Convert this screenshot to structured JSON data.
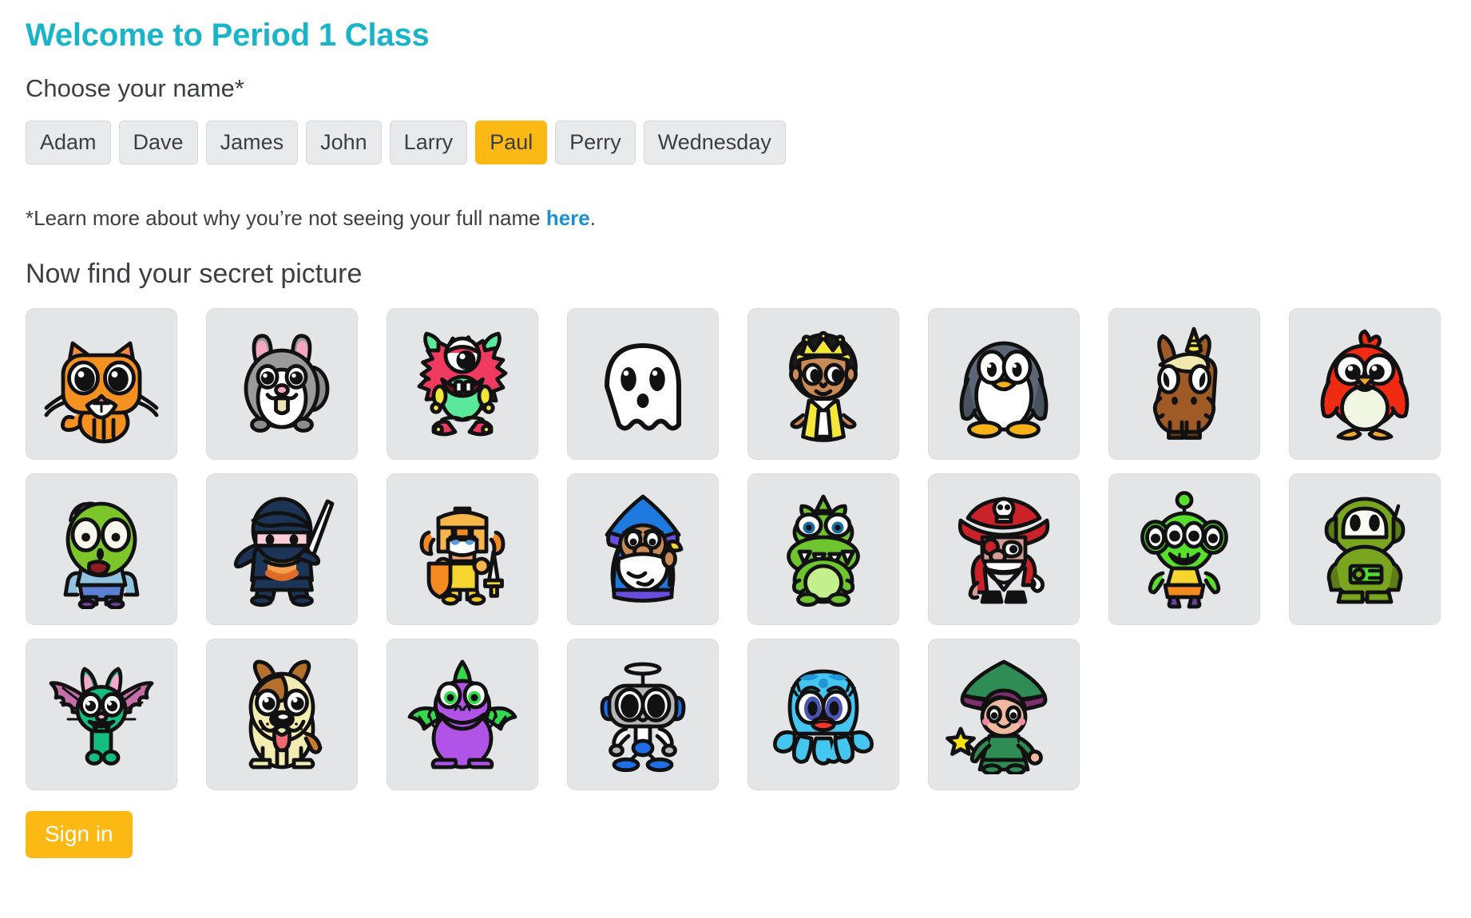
{
  "header": {
    "title": "Welcome to Period 1 Class"
  },
  "name_section": {
    "label": "Choose your name*",
    "names": [
      {
        "label": "Adam",
        "selected": false
      },
      {
        "label": "Dave",
        "selected": false
      },
      {
        "label": "James",
        "selected": false
      },
      {
        "label": "John",
        "selected": false
      },
      {
        "label": "Larry",
        "selected": false
      },
      {
        "label": "Paul",
        "selected": true
      },
      {
        "label": "Perry",
        "selected": false
      },
      {
        "label": "Wednesday",
        "selected": false
      }
    ],
    "selected_name": "Paul"
  },
  "note": {
    "prefix": "*Learn more about why you’re not seeing your full name ",
    "link_text": "here",
    "suffix": "."
  },
  "picture_section": {
    "title": "Now find your secret picture",
    "pictures": [
      {
        "name": "cat",
        "label": "Cat"
      },
      {
        "name": "hamster",
        "label": "Hamster"
      },
      {
        "name": "monster",
        "label": "Monster"
      },
      {
        "name": "ghost",
        "label": "Ghost"
      },
      {
        "name": "princess",
        "label": "Princess"
      },
      {
        "name": "penguin",
        "label": "Penguin"
      },
      {
        "name": "unicorn",
        "label": "Unicorn"
      },
      {
        "name": "bird",
        "label": "Bird"
      },
      {
        "name": "zombie",
        "label": "Zombie"
      },
      {
        "name": "ninja",
        "label": "Ninja"
      },
      {
        "name": "knight",
        "label": "Knight"
      },
      {
        "name": "wizard",
        "label": "Wizard"
      },
      {
        "name": "dinosaur",
        "label": "Dinosaur"
      },
      {
        "name": "pirate",
        "label": "Pirate"
      },
      {
        "name": "alien",
        "label": "Alien"
      },
      {
        "name": "astronaut",
        "label": "Astronaut"
      },
      {
        "name": "bat",
        "label": "Bat"
      },
      {
        "name": "dog",
        "label": "Dog"
      },
      {
        "name": "dragon",
        "label": "Dragon"
      },
      {
        "name": "robot",
        "label": "Robot"
      },
      {
        "name": "octopus",
        "label": "Octopus"
      },
      {
        "name": "fairy",
        "label": "Fairy"
      }
    ]
  },
  "footer": {
    "signin_label": "Sign in"
  },
  "colors": {
    "title_teal": "#1ab4c8",
    "accent_amber": "#fdb913",
    "link_blue": "#1a92d1",
    "tile_gray": "#e3e5e7",
    "button_gray": "#e9eaec",
    "text": "#3b3f44"
  }
}
